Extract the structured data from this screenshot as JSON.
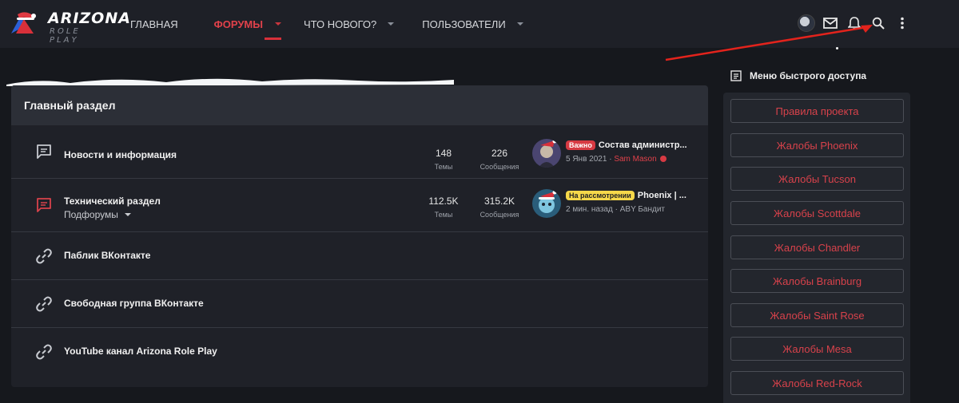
{
  "brand": {
    "title": "ARIZONA",
    "subtitle": "ROLE PLAY"
  },
  "nav": {
    "items": [
      {
        "label": "ГЛАВНАЯ",
        "has_caret": false
      },
      {
        "label": "ФОРУМЫ",
        "has_caret": true,
        "active": true
      },
      {
        "label": "ЧТО НОВОГО?",
        "has_caret": true
      },
      {
        "label": "ПОЛЬЗОВАТЕЛИ",
        "has_caret": true
      }
    ]
  },
  "header_icons": [
    "avatar",
    "mail-icon",
    "bell-icon",
    "search-icon",
    "more-vert-icon"
  ],
  "colors": {
    "accent": "#d8303a",
    "bg": "#16181d",
    "card": "#1f2128",
    "header": "#2c2f37"
  },
  "section": {
    "title": "Главный раздел",
    "forums": [
      {
        "title": "Новости и информация",
        "icon": "chat-icon",
        "threads": "148",
        "threads_label": "Темы",
        "messages": "226",
        "messages_label": "Сообщения",
        "last": {
          "badge": "Важно",
          "title": "Состав администр...",
          "date": "5 Янв 2021",
          "sep": " · ",
          "user": "Sam Mason"
        }
      },
      {
        "title": "Технический раздел",
        "icon": "chat-icon",
        "subforums": "Подфорумы",
        "threads": "112.5K",
        "threads_label": "Темы",
        "messages": "315.2K",
        "messages_label": "Сообщения",
        "last": {
          "badge": "На рассмотрении",
          "title": "Phoenix | ...",
          "date": "2 мин. назад",
          "sep": " · ",
          "user": "ABY Бандит"
        }
      }
    ],
    "links": [
      {
        "title": "Паблик ВКонтакте",
        "icon": "link-icon"
      },
      {
        "title": "Свободная группа ВКонтакте",
        "icon": "link-icon"
      },
      {
        "title": "YouTube канал Arizona Role Play",
        "icon": "link-icon"
      }
    ]
  },
  "sidebar": {
    "title": "Меню быстрого доступа",
    "buttons": [
      "Правила проекта",
      "Жалобы Phoenix",
      "Жалобы Tucson",
      "Жалобы Scottdale",
      "Жалобы Chandler",
      "Жалобы Brainburg",
      "Жалобы Saint Rose",
      "Жалобы Mesa",
      "Жалобы Red-Rock"
    ]
  }
}
